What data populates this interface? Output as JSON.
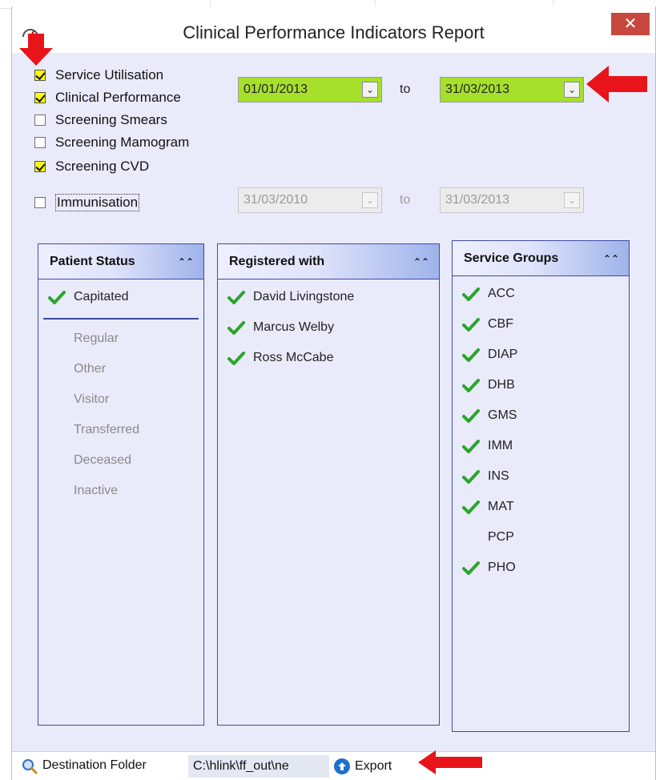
{
  "window": {
    "title": "Clinical Performance Indicators Report",
    "close_symbol": "✕"
  },
  "options": [
    {
      "label": "Service Utilisation",
      "checked": true
    },
    {
      "label": "Clinical Performance",
      "checked": true
    },
    {
      "label": "Screening Smears",
      "checked": false
    },
    {
      "label": "Screening Mamogram",
      "checked": false
    },
    {
      "label": "Screening CVD",
      "checked": true
    },
    {
      "label": "Immunisation",
      "checked": false
    }
  ],
  "date_range": {
    "from": "01/01/2013",
    "to_label": "to",
    "to": "31/03/2013"
  },
  "immunisation_range": {
    "from": "31/03/2010",
    "to_label": "to",
    "to": "31/03/2013"
  },
  "panels": {
    "patient_status": {
      "title": "Patient Status",
      "selected": [
        "Capitated"
      ],
      "others": [
        "Regular",
        "Other",
        "Visitor",
        "Transferred",
        "Deceased",
        "Inactive"
      ]
    },
    "registered_with": {
      "title": "Registered with",
      "items": [
        "David Livingstone",
        "Marcus Welby",
        "Ross McCabe"
      ]
    },
    "service_groups": {
      "title": "Service Groups",
      "items": [
        {
          "label": "ACC",
          "checked": true
        },
        {
          "label": "CBF",
          "checked": true
        },
        {
          "label": "DIAP",
          "checked": true
        },
        {
          "label": "DHB",
          "checked": true
        },
        {
          "label": "GMS",
          "checked": true
        },
        {
          "label": "IMM",
          "checked": true
        },
        {
          "label": "INS",
          "checked": true
        },
        {
          "label": "MAT",
          "checked": true
        },
        {
          "label": "PCP",
          "checked": false
        },
        {
          "label": "PHO",
          "checked": true
        }
      ]
    }
  },
  "bottom": {
    "destination_label": "Destination Folder",
    "destination_path": "C:\\hlink\\ff_out\\ne",
    "export_label": "Export"
  },
  "colors": {
    "accent_green": "#a6e02c",
    "checkbox_yellow": "#ffff00",
    "panel_border": "#3f4aa0",
    "check_green": "#2aa52a",
    "annotation_red": "#e8141a",
    "close_red": "#c7483e"
  }
}
